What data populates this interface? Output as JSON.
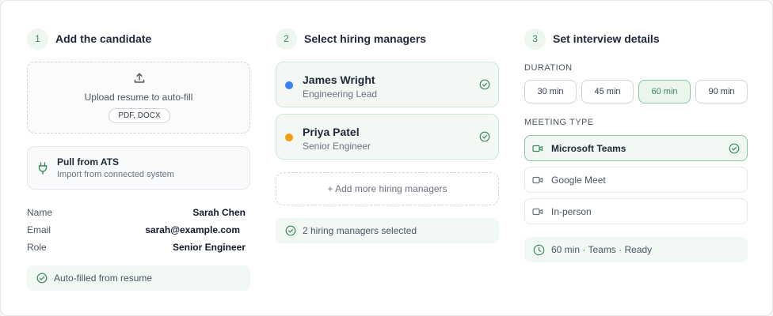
{
  "colors": {
    "accent": "#3d8a5a",
    "accent_light": "#eaf5ee",
    "dot_blue": "#3b82f6",
    "dot_amber": "#f59e0b"
  },
  "steps": [
    {
      "number": "1",
      "title": "Add the candidate"
    },
    {
      "number": "2",
      "title": "Select hiring managers"
    },
    {
      "number": "3",
      "title": "Set interview details"
    }
  ],
  "candidate": {
    "upload": {
      "icon": "upload-icon",
      "text": "Upload resume to auto-fill",
      "formats": "PDF, DOCX"
    },
    "ats": {
      "icon": "plug-icon",
      "title": "Pull from ATS",
      "subtitle": "Import from connected system"
    },
    "fields": [
      {
        "label": "Name",
        "value": "Sarah Chen"
      },
      {
        "label": "Email",
        "value": "sarah@example.com"
      },
      {
        "label": "Role",
        "value": "Senior Engineer"
      }
    ],
    "status": "Auto-filled from resume"
  },
  "managers": {
    "items": [
      {
        "name": "James Wright",
        "role": "Engineering Lead",
        "dot": "blue"
      },
      {
        "name": "Priya Patel",
        "role": "Senior Engineer",
        "dot": "amber"
      }
    ],
    "add_more": "+ Add more hiring managers",
    "status": "2 hiring managers selected"
  },
  "interview": {
    "duration_label": "DURATION",
    "durations": [
      "30 min",
      "45 min",
      "60 min",
      "90 min"
    ],
    "selected_duration": "60 min",
    "meeting_type_label": "MEETING TYPE",
    "meeting_types": [
      "Microsoft Teams",
      "Google Meet",
      "In-person"
    ],
    "selected_meeting_type": "Microsoft Teams",
    "summary": "60 min · Teams · Ready"
  }
}
